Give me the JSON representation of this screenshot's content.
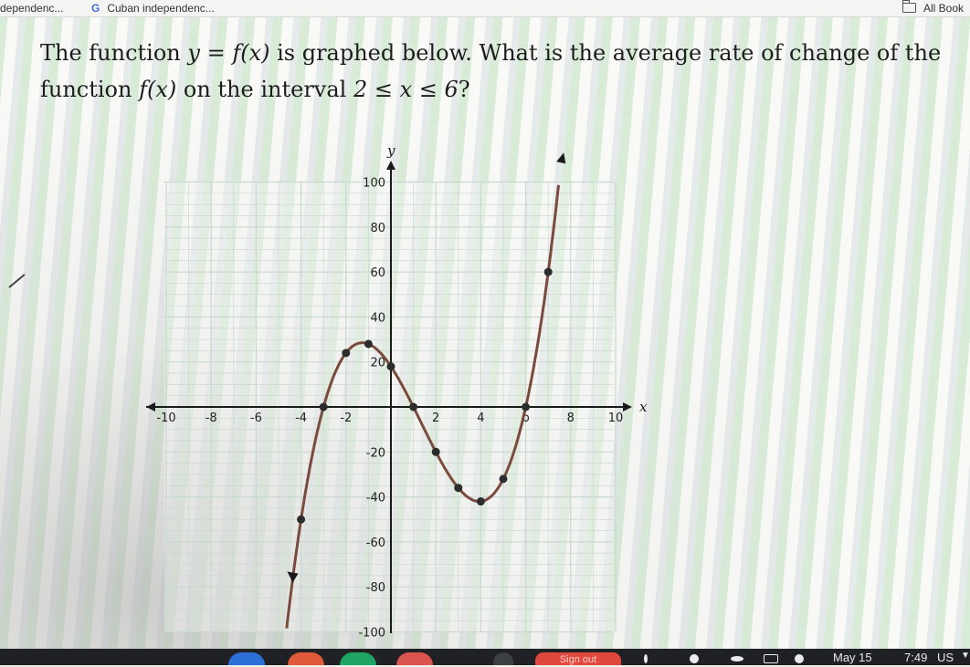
{
  "bookmarks": {
    "items": [
      {
        "label": "dependenc..."
      },
      {
        "label": "Cuban independenc...",
        "icon": "google-icon"
      },
      {
        "label": "All Book",
        "icon": "folder-icon"
      }
    ]
  },
  "question": {
    "part1": "The function ",
    "math1": "y = f(x)",
    "part2": " is graphed below. What is the average rate of change of the function ",
    "math2": "f(x)",
    "part3": " on the interval ",
    "math3": "2 ≤ x ≤ 6",
    "part4": "?"
  },
  "chart_data": {
    "type": "line",
    "xlabel": "x",
    "ylabel": "y",
    "xlim": [
      -10,
      10
    ],
    "ylim": [
      -100,
      100
    ],
    "grid": true,
    "x_ticks": [
      -10,
      -8,
      -6,
      -4,
      -2,
      2,
      4,
      6,
      8,
      10
    ],
    "x_tick_labels": [
      "-10",
      "-8",
      "-6",
      "-4",
      "-2",
      "2",
      "4",
      "b",
      "8",
      "10"
    ],
    "y_ticks": [
      -100,
      -80,
      -60,
      -40,
      -20,
      20,
      40,
      60,
      80,
      100
    ],
    "y_tick_labels": [
      "-100",
      "-80",
      "-60",
      "-40",
      "-20",
      "20",
      "40",
      "60",
      "80",
      "100"
    ],
    "series": [
      {
        "function": "(x+3)(x-1)(x-6)",
        "points": [
          {
            "x": -4,
            "y": -50
          },
          {
            "x": -3,
            "y": 0
          },
          {
            "x": -2,
            "y": 24
          },
          {
            "x": -1,
            "y": 28
          },
          {
            "x": 0,
            "y": 18
          },
          {
            "x": 1,
            "y": 0
          },
          {
            "x": 2,
            "y": -20
          },
          {
            "x": 3,
            "y": -36
          },
          {
            "x": 4,
            "y": -42
          },
          {
            "x": 5,
            "y": -32
          },
          {
            "x": 6,
            "y": 0
          },
          {
            "x": 7,
            "y": 60
          }
        ]
      }
    ]
  },
  "taskbar": {
    "signout_label": "Sign out",
    "date": "May 15",
    "time": "7:49",
    "locale": "US"
  },
  "colors": {
    "curve": "#7a4a3c",
    "point": "#2c2c2c",
    "grid": "#c9d9cf",
    "axis": "#1a1a1a",
    "taskbar": "#202124",
    "signout": "#e0483d"
  }
}
